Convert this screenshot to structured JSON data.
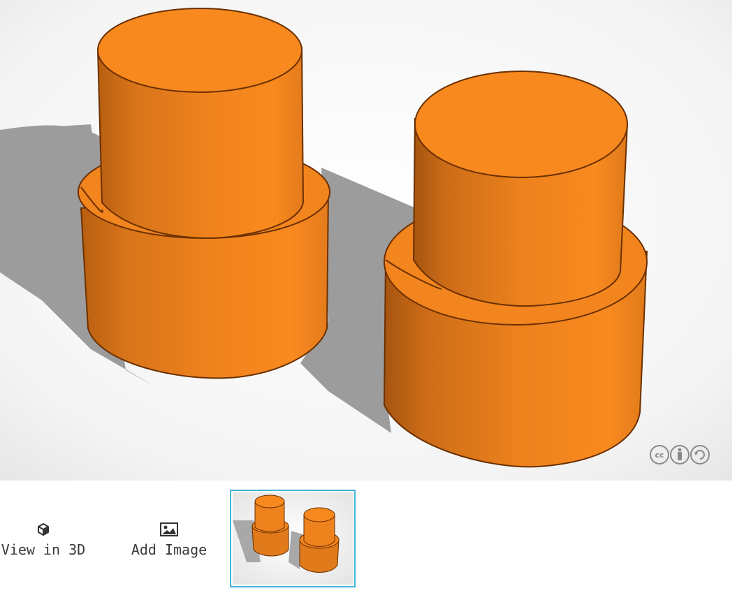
{
  "toolbar": {
    "view_3d_label": "View in 3D",
    "add_image_label": "Add Image"
  },
  "license": {
    "icons": [
      "cc-icon",
      "attribution-icon",
      "share-alike-icon"
    ]
  },
  "colors": {
    "accent": "#3fb5da",
    "shape_orange": "#f7871c",
    "shadow": "#9a9a9a"
  }
}
